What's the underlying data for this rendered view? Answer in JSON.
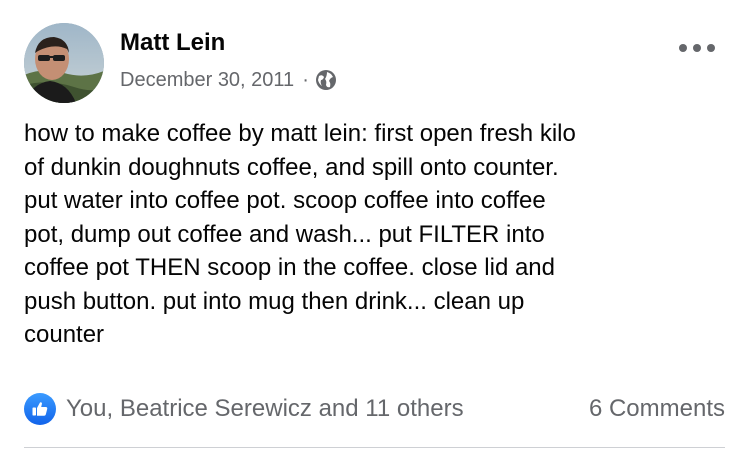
{
  "post": {
    "author": "Matt Lein",
    "date": "December 30, 2011",
    "separator": "·",
    "privacy_icon": "globe-icon",
    "more_icon": "more-options-icon",
    "text": "how to make coffee by matt lein: first open fresh kilo\nof dunkin doughnuts coffee, and spill onto counter.\nput water into coffee pot. scoop coffee into coffee\npot, dump out coffee and wash... put FILTER into\ncoffee pot THEN scoop in the coffee. close lid and\npush button. put into mug then drink... clean up\ncounter"
  },
  "footer": {
    "reaction_icon": "like-icon",
    "reactions_text": "You, Beatrice Serewicz and 11 others",
    "comments_text": "6 Comments"
  },
  "colors": {
    "text_primary": "#050505",
    "text_secondary": "#65676b",
    "like_blue": "#1877f2",
    "divider": "#ced0d4"
  }
}
